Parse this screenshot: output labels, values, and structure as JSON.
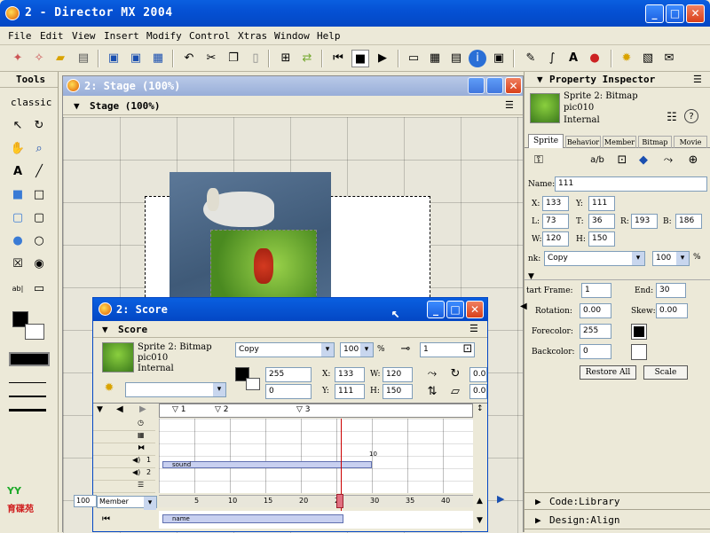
{
  "window": {
    "title": "2 - Director MX 2004",
    "min": "_",
    "max": "□",
    "close": "✕"
  },
  "menu": [
    "File",
    "Edit",
    "View",
    "Insert",
    "Modify",
    "Control",
    "Xtras",
    "Window",
    "Help"
  ],
  "tools": {
    "title": "Tools",
    "mode": "classic"
  },
  "stage": {
    "window_title": "2: Stage (100%)",
    "panel_title": "Stage (100%)"
  },
  "score": {
    "window_title": "2: Score",
    "panel_title": "Score",
    "sprite_name": "Sprite 2: Bitmap",
    "member": "pic010",
    "cast": "Internal",
    "ink": "Copy",
    "blend": "100",
    "blend_unit": "%",
    "start": "1",
    "fore": "255",
    "back": "0",
    "x": "133",
    "y": "111",
    "w": "120",
    "h": "150",
    "extra": "0.0",
    "markers": [
      "1",
      "2",
      "3"
    ],
    "sound_label": "sound",
    "name_label": "name",
    "ruler": [
      "5",
      "10",
      "15",
      "20",
      "25",
      "30",
      "35",
      "40"
    ],
    "channel_nums": [
      "1",
      "2"
    ],
    "zoom": "100",
    "member_select": "Member",
    "frame_end_marker": "10"
  },
  "inspector": {
    "title": "Property Inspector",
    "sprite_name": "Sprite 2: Bitmap",
    "member": "pic010",
    "cast": "Internal",
    "tabs": [
      "Sprite",
      "Behavior",
      "Member",
      "Bitmap",
      "Movie"
    ],
    "name_label": "Name:",
    "name_value": "111",
    "x_label": "X:",
    "x": "133",
    "y_label": "Y:",
    "y": "111",
    "l_label": "L:",
    "l": "73",
    "t_label": "T:",
    "t": "36",
    "r_label": "R:",
    "r": "193",
    "b_label": "B:",
    "b": "186",
    "w_label": "W:",
    "w": "120",
    "h_label": "H:",
    "h": "150",
    "ink_label": "nk:",
    "ink": "Copy",
    "blend": "100",
    "start_label": "tart Frame:",
    "start": "1",
    "end_label": "End:",
    "end": "30",
    "rotation_label": "Rotation:",
    "rotation": "0.00",
    "skew_label": "Skew:",
    "skew": "0.00",
    "fore_label": "Forecolor:",
    "fore": "255",
    "back_label": "Backcolor:",
    "back": "0",
    "restore_btn": "Restore All",
    "scale_btn": "Scale",
    "code_panel": "Code:Library",
    "design_panel": "Design:Align"
  },
  "logo": {
    "text": "育碟苑"
  }
}
